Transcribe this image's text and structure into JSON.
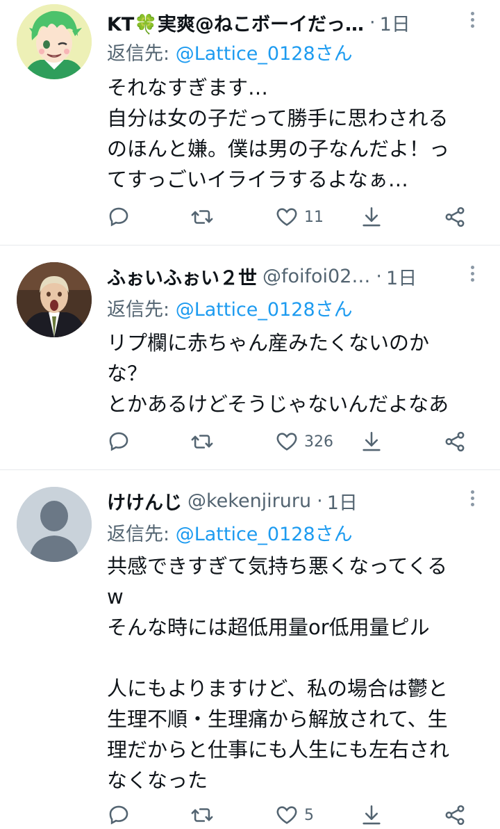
{
  "tweets": [
    {
      "name": "KT🍀実爽@ねこボーイだっ…",
      "handle": "",
      "sep": "·",
      "time": "1日",
      "reply_prefix": "返信先: ",
      "reply_handle": "@Lattice_0128さん",
      "lines": [
        "それなすぎます…",
        "自分は女の子だって勝手に思わされる",
        "のほんと嫌。僕は男の子なんだよ！っ",
        "てすっごいイライラするよなぁ…"
      ],
      "counts": {
        "reply": "",
        "retweet": "",
        "like": "11"
      }
    },
    {
      "name": "ふぉいふぉい２世",
      "handle": "@foifoi02…",
      "sep": "·",
      "time": "1日",
      "reply_prefix": "返信先: ",
      "reply_handle": "@Lattice_0128さん",
      "lines": [
        "リプ欄に赤ちゃん産みたくないのか",
        "な？",
        "とかあるけどそうじゃないんだよなあ"
      ],
      "counts": {
        "reply": "",
        "retweet": "",
        "like": "326"
      }
    },
    {
      "name": "けけんじ",
      "handle": "@kekenjiruru",
      "sep": "·",
      "time": "1日",
      "reply_prefix": "返信先: ",
      "reply_handle": "@Lattice_0128さん",
      "lines": [
        "共感できすぎて気持ち悪くなってくる",
        "w",
        "そんな時には超低用量or低用量ピル",
        "",
        "人にもよりますけど、私の場合は鬱と",
        "生理不順・生理痛から解放されて、生",
        "理だからと仕事にも人生にも左右され",
        "なくなった"
      ],
      "counts": {
        "reply": "",
        "retweet": "",
        "like": "5"
      }
    }
  ],
  "colors": {
    "text": "#0f1419",
    "muted": "#536471",
    "accent": "#1d9bf0",
    "divider": "#e6e9ec"
  },
  "icons": [
    "reply-icon",
    "retweet-icon",
    "like-icon",
    "bookmark-icon",
    "share-icon",
    "more-icon"
  ]
}
